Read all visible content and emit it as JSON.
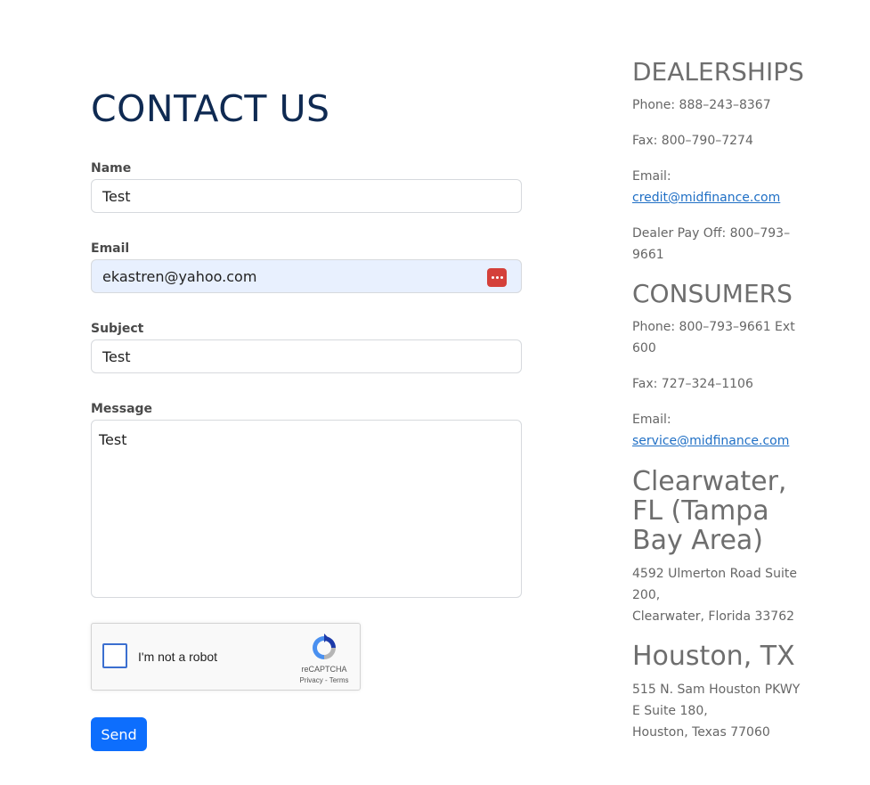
{
  "form": {
    "title": "CONTACT US",
    "name_label": "Name",
    "name_value": "Test",
    "email_label": "Email",
    "email_value": "ekastren@yahoo.com",
    "subject_label": "Subject",
    "subject_value": "Test",
    "message_label": "Message",
    "message_value": "Test",
    "send_label": "Send"
  },
  "captcha": {
    "label": "I'm not a robot",
    "brand": "reCAPTCHA",
    "terms": "Privacy - Terms"
  },
  "dealerships": {
    "heading": "DEALERSHIPS",
    "phone": "Phone: 888–243–8367",
    "fax": "Fax: 800–790–7274",
    "email_label": "Email:",
    "email": "credit@midfinance.com",
    "payoff_line1": "Dealer Pay Off: 800–793–",
    "payoff_line2": "9661"
  },
  "consumers": {
    "heading": "CONSUMERS",
    "phone_line1": "Phone: 800–793–9661 Ext",
    "phone_line2": "600",
    "fax": "Fax: 727–324–1106",
    "email_label": "Email:",
    "email": "service@midfinance.com"
  },
  "clearwater": {
    "heading_line1": "Clearwater,",
    "heading_line2": "FL (Tampa",
    "heading_line3": "Bay Area)",
    "address_line1": "4592 Ulmerton Road Suite",
    "address_line2": "200,",
    "address_line3": "Clearwater, Florida 33762"
  },
  "houston": {
    "heading": "Houston, TX",
    "address_line1": "515 N. Sam Houston PKWY",
    "address_line2": "E Suite 180,",
    "address_line3": "Houston, Texas 77060"
  },
  "colors": {
    "title": "#0f2a52",
    "button": "#0d6efd",
    "link": "#1f6fc5",
    "autofill_bg": "#e8f0fe",
    "password_icon": "#d4403a"
  }
}
